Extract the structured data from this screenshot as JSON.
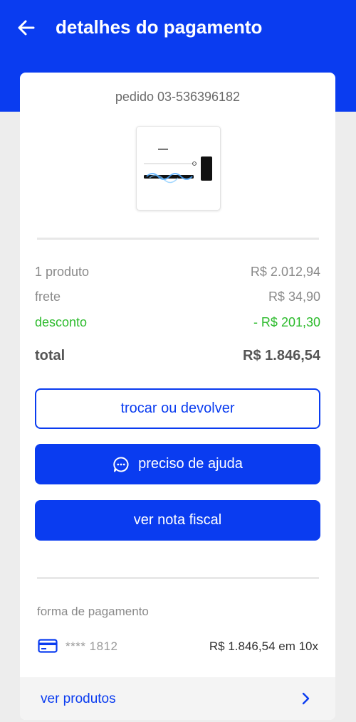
{
  "header": {
    "title": "detalhes do pagamento"
  },
  "order": {
    "id_label": "pedido 03-536396182"
  },
  "summary": {
    "items_label": "1 produto",
    "items_value": "R$ 2.012,94",
    "shipping_label": "frete",
    "shipping_value": "R$ 34,90",
    "discount_label": "desconto",
    "discount_value": "- R$ 201,30",
    "total_label": "total",
    "total_value": "R$ 1.846,54"
  },
  "actions": {
    "exchange_label": "trocar ou devolver",
    "help_label": "preciso de ajuda",
    "invoice_label": "ver nota fiscal"
  },
  "payment": {
    "section_label": "forma de pagamento",
    "card_masked": "**** 1812",
    "amount": "R$ 1.846,54 em 10x"
  },
  "footer": {
    "view_products_label": "ver produtos"
  },
  "colors": {
    "brand_blue": "#0a3cf0",
    "discount_green": "#2dbb2d"
  },
  "icons": {
    "back": "arrow-left-icon",
    "help": "chat-bubble-icon",
    "card": "credit-card-icon",
    "forward": "chevron-right-icon"
  }
}
